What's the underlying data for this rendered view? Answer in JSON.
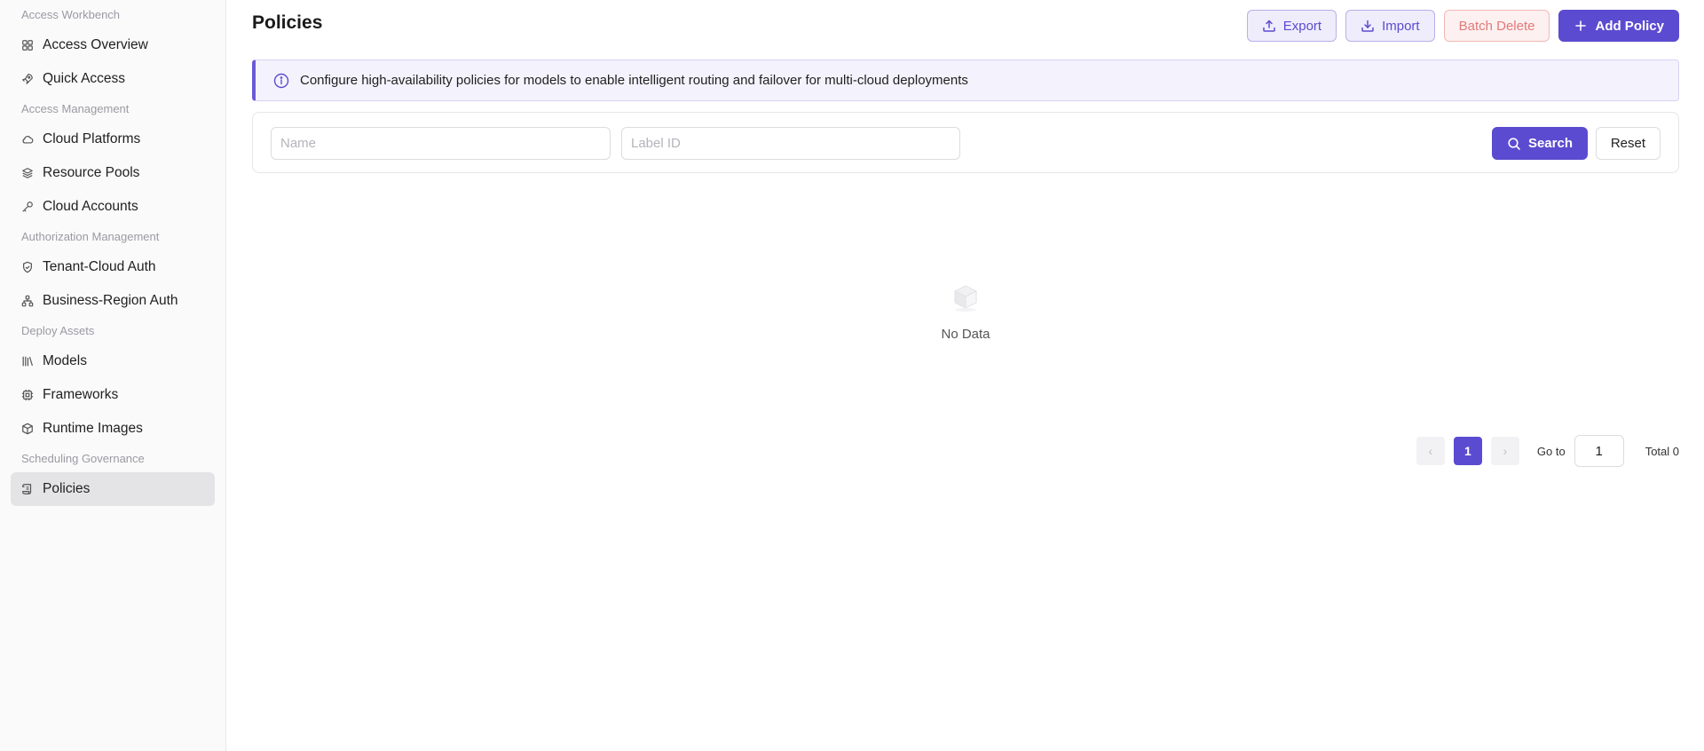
{
  "sidebar": {
    "groups": [
      {
        "label": "Access Workbench",
        "items": [
          {
            "label": "Access Overview",
            "icon": "grid-icon"
          },
          {
            "label": "Quick Access",
            "icon": "rocket-icon"
          }
        ]
      },
      {
        "label": "Access Management",
        "items": [
          {
            "label": "Cloud Platforms",
            "icon": "cloud-icon"
          },
          {
            "label": "Resource Pools",
            "icon": "layers-icon"
          },
          {
            "label": "Cloud Accounts",
            "icon": "key-icon"
          }
        ]
      },
      {
        "label": "Authorization Management",
        "items": [
          {
            "label": "Tenant-Cloud Auth",
            "icon": "shield-check-icon"
          },
          {
            "label": "Business-Region Auth",
            "icon": "network-icon"
          }
        ]
      },
      {
        "label": "Deploy Assets",
        "items": [
          {
            "label": "Models",
            "icon": "library-icon"
          },
          {
            "label": "Frameworks",
            "icon": "cpu-icon"
          },
          {
            "label": "Runtime Images",
            "icon": "package-icon"
          }
        ]
      },
      {
        "label": "Scheduling Governance",
        "items": [
          {
            "label": "Policies",
            "icon": "scroll-icon",
            "active": true
          }
        ]
      }
    ]
  },
  "header": {
    "title": "Policies",
    "export_label": "Export",
    "import_label": "Import",
    "batch_delete_label": "Batch Delete",
    "add_label": "Add Policy"
  },
  "alert": {
    "text": "Configure high-availability policies for models to enable intelligent routing and failover for multi-cloud deployments"
  },
  "filters": {
    "name_placeholder": "Name",
    "name_value": "",
    "label_placeholder": "Label ID",
    "label_value": "",
    "search_label": "Search",
    "reset_label": "Reset"
  },
  "empty": {
    "text": "No Data"
  },
  "pagination": {
    "current_page": "1",
    "goto_label": "Go to",
    "goto_value": "1",
    "total_label": "Total 0"
  },
  "colors": {
    "primary": "#5b4bd0",
    "danger": "#e27a7a",
    "sidebar_bg": "#fafafa",
    "active_item_bg": "#e4e4e6"
  }
}
